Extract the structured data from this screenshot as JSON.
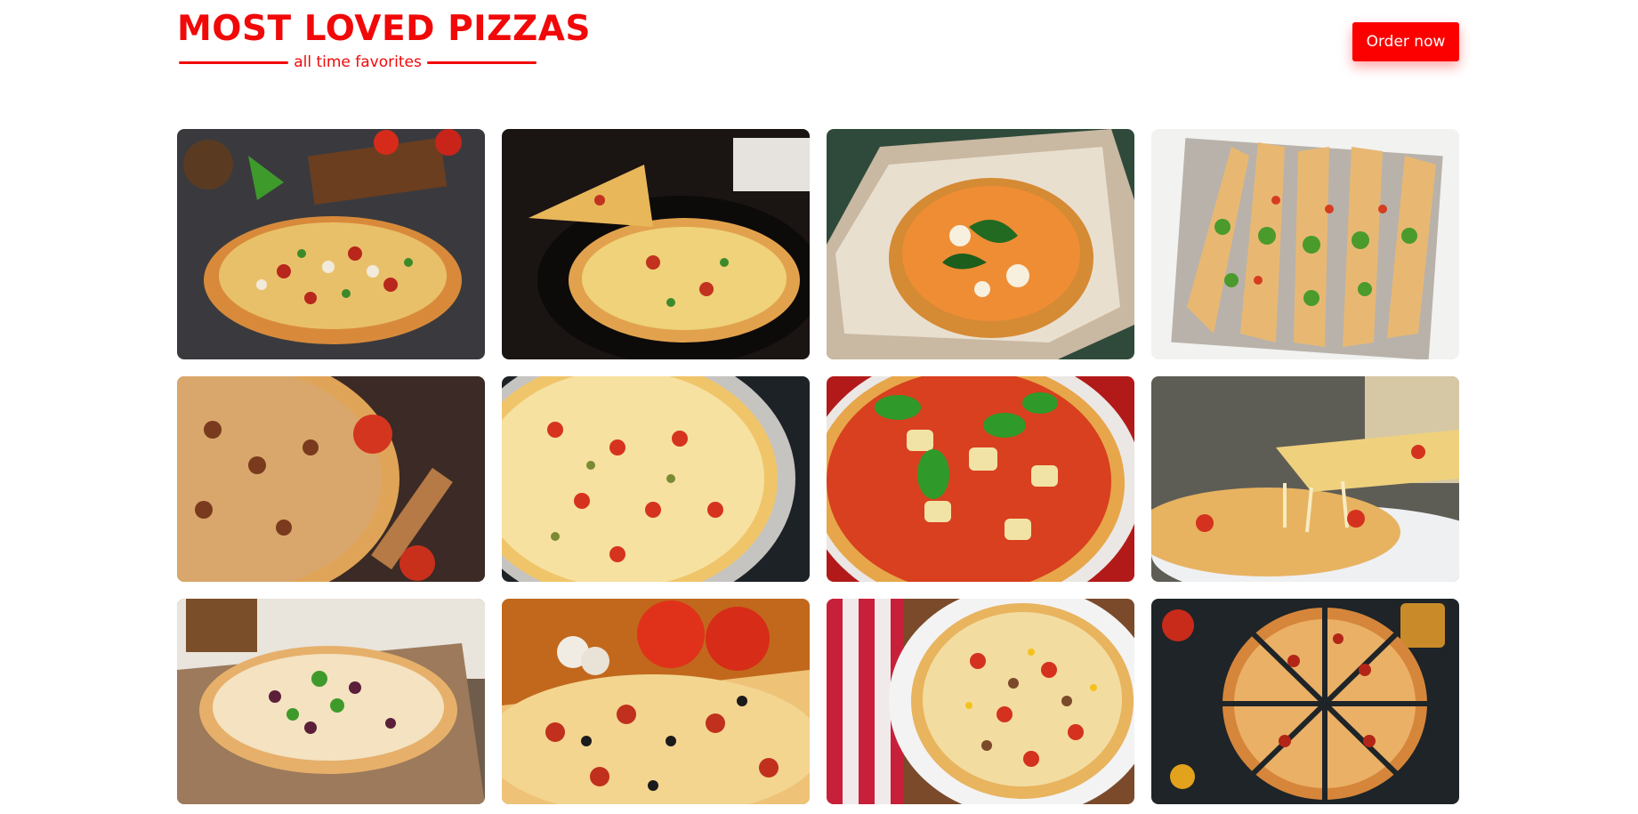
{
  "header": {
    "title": "MOST LOVED PIZZAS",
    "subtitle": "all time favorites",
    "order_button": "Order now",
    "accent_color": "#f10808"
  },
  "gallery": {
    "images": [
      {
        "alt": "pizza with peppers and mushrooms on dark table"
      },
      {
        "alt": "pizza slice lifted from pan"
      },
      {
        "alt": "margherita pizza in box"
      },
      {
        "alt": "arugula pizza slices on tray"
      },
      {
        "alt": "sliced pizza with tomatoes and rolling pin"
      },
      {
        "alt": "pizza with olives and tomatoes"
      },
      {
        "alt": "pizza with basil and artichokes"
      },
      {
        "alt": "cheesy pizza slice pull"
      },
      {
        "alt": "pizza on wooden board"
      },
      {
        "alt": "pizza with mushrooms and tomatoes"
      },
      {
        "alt": "pizza on plate with checkered napkin"
      },
      {
        "alt": "sliced pizza on dark background"
      }
    ]
  }
}
